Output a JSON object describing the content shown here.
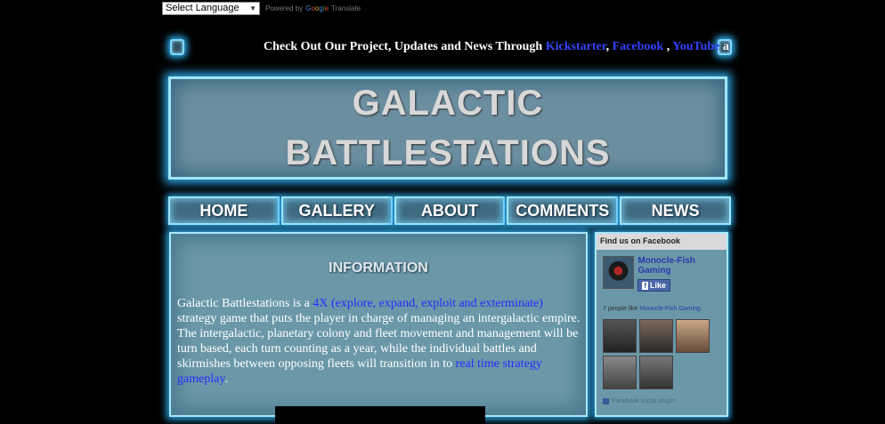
{
  "translate": {
    "select_value": "Select Language",
    "powered_by": "Powered by",
    "google": [
      "G",
      "o",
      "o",
      "g",
      "l",
      "e"
    ],
    "translate_label": "Translate"
  },
  "notice": {
    "text": "Check Out Our Project, Updates and News Through ",
    "kickstarter": "Kickstarter",
    "sep1": ", ",
    "facebook": "Facebook",
    "sep2": " , ",
    "youtube": "YouTube",
    "trail": " a"
  },
  "banner": {
    "line1": "GALACTIC",
    "line2": "BATTLESTATIONS"
  },
  "nav": {
    "home": "HOME",
    "gallery": "GALLERY",
    "about": "ABOUT",
    "comments": "COMMENTS",
    "news": "NEWS"
  },
  "info": {
    "heading": "INFORMATION",
    "text_start": "Galactic Battlestations is a ",
    "link1": "4X (explore, expand, exploit and exterminate)",
    "text_mid": " strategy game that puts the player in charge of managing an intergalactic empire. The intergalactic, planetary colony and fleet movement and management will be turn based, each turn counting as a year, while the individual battles and skirmishes between opposing fleets will transition in to ",
    "link2": "real time strategy gameplay",
    "text_end": "."
  },
  "facebook_box": {
    "header": "Find us on Facebook",
    "page_name": "Monocle-Fish Gaming",
    "like_f": "f",
    "like_label": "Like",
    "count_prefix": "7 people like ",
    "count_link": "Monocle-Fish Gaming",
    "count_suffix": ".",
    "plugin": "Facebook social plugin"
  }
}
